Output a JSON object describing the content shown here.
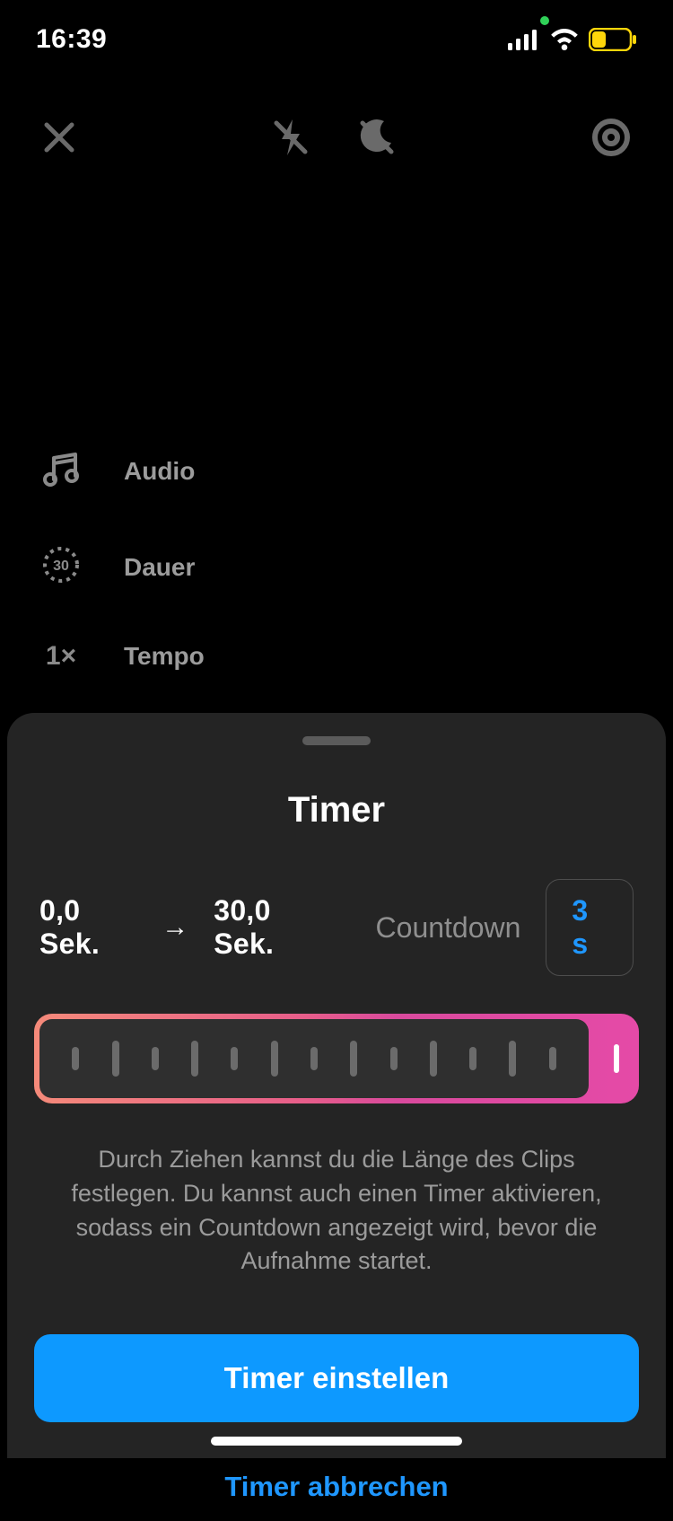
{
  "statusbar": {
    "time": "16:39"
  },
  "topbar": {
    "close": "close-icon",
    "flash": "flash-off-icon",
    "night": "night-mode-off-icon",
    "settings": "settings-icon"
  },
  "tools": {
    "audio": {
      "label": "Audio"
    },
    "duration": {
      "label": "Dauer",
      "value": "30"
    },
    "speed": {
      "label": "Tempo",
      "value": "1×"
    }
  },
  "sheet": {
    "title": "Timer",
    "start": "0,0 Sek.",
    "arrow": "→",
    "end": "30,0 Sek.",
    "countdown_label": "Countdown",
    "countdown_value": "3 s",
    "help": "Durch Ziehen kannst du die Länge des Clips festlegen. Du kannst auch einen Timer aktivieren, sodass ein Countdown angezeigt wird, bevor die Aufnahme startet.",
    "primary": "Timer einstellen",
    "secondary": "Timer abbrechen"
  }
}
